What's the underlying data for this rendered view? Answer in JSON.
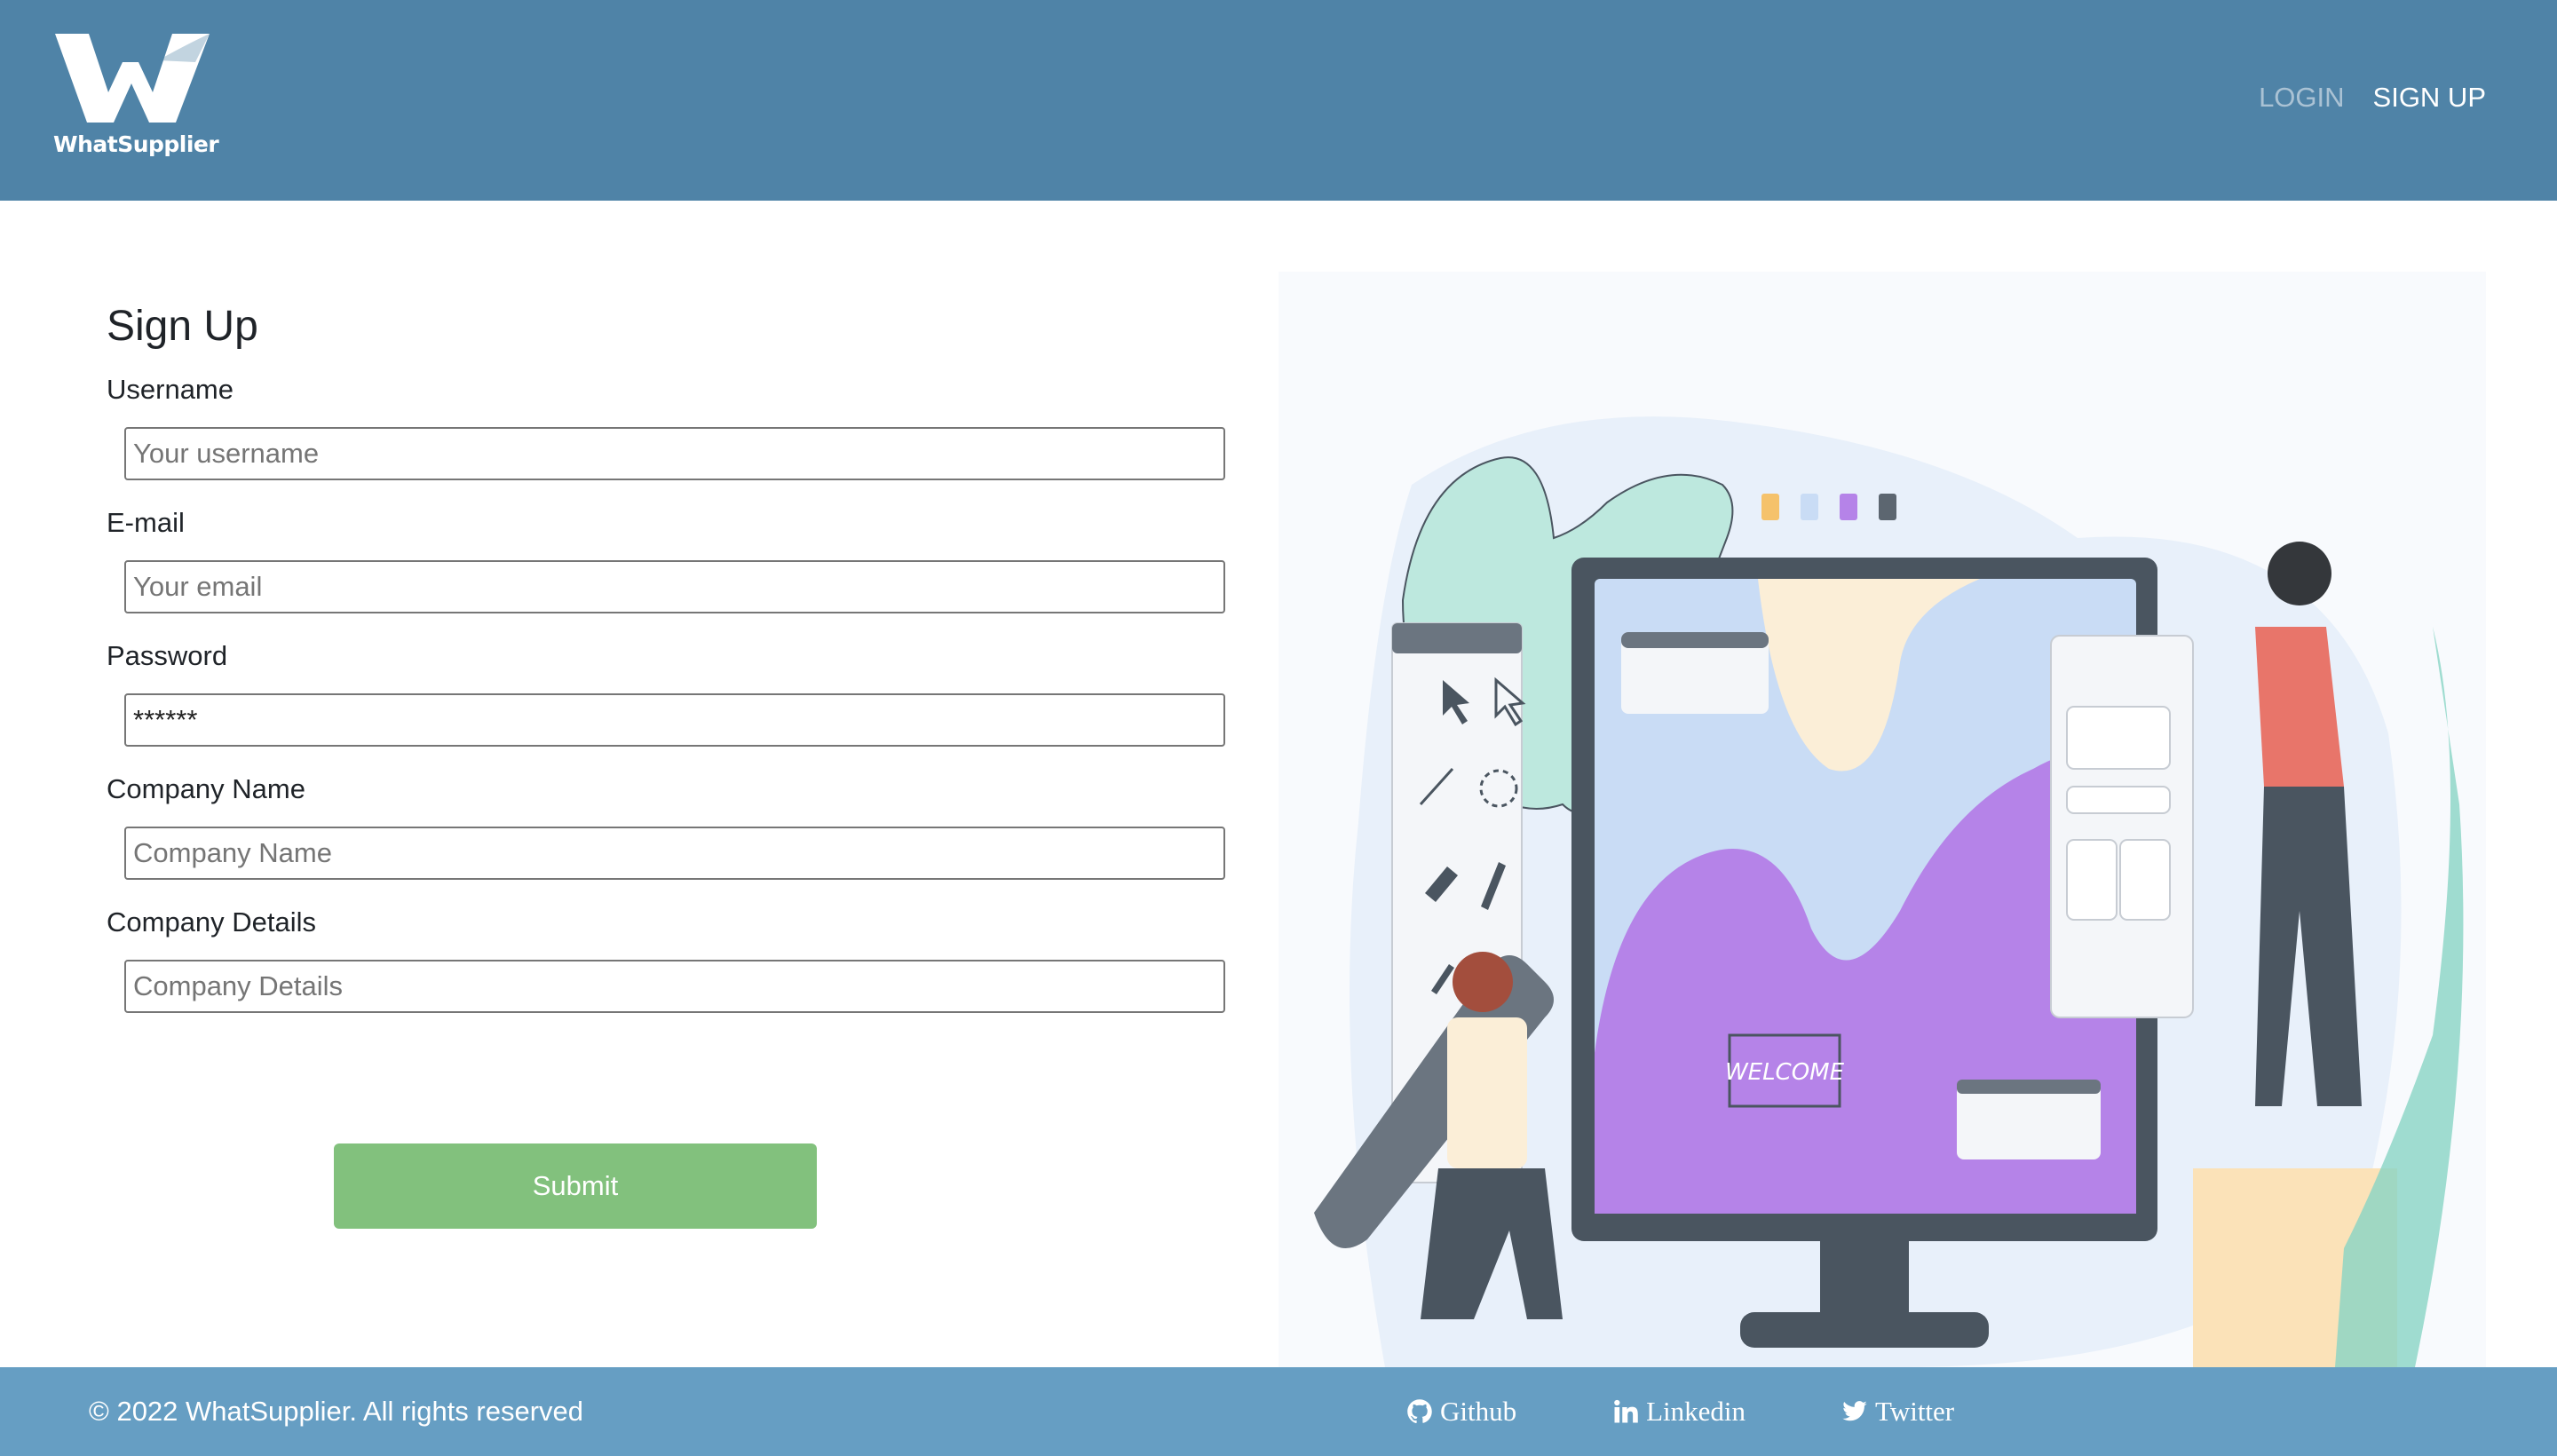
{
  "header": {
    "brand": "WhatSupplier",
    "nav": {
      "login": "LOGIN",
      "signup": "SIGN UP"
    }
  },
  "form": {
    "title": "Sign Up",
    "fields": [
      {
        "label": "Username",
        "placeholder": "Your username",
        "value": ""
      },
      {
        "label": "E-mail",
        "placeholder": "Your email",
        "value": ""
      },
      {
        "label": "Password",
        "placeholder": "",
        "value": "******"
      },
      {
        "label": "Company Name",
        "placeholder": "Company Name",
        "value": ""
      },
      {
        "label": "Company Details",
        "placeholder": "Company Details",
        "value": ""
      }
    ],
    "submit_label": "Submit"
  },
  "illustration": {
    "sign_text": "WELCOME"
  },
  "footer": {
    "copyright": "© 2022 WhatSupplier. All rights reserved",
    "social": [
      {
        "label": "Github",
        "icon": "github-icon"
      },
      {
        "label": "Linkedin",
        "icon": "linkedin-icon"
      },
      {
        "label": "Twitter",
        "icon": "twitter-icon"
      }
    ]
  },
  "colors": {
    "header_bg": "#4f83a7",
    "footer_bg": "#669ec3",
    "submit_bg": "#82c17d",
    "accent_purple": "#b583e8"
  }
}
